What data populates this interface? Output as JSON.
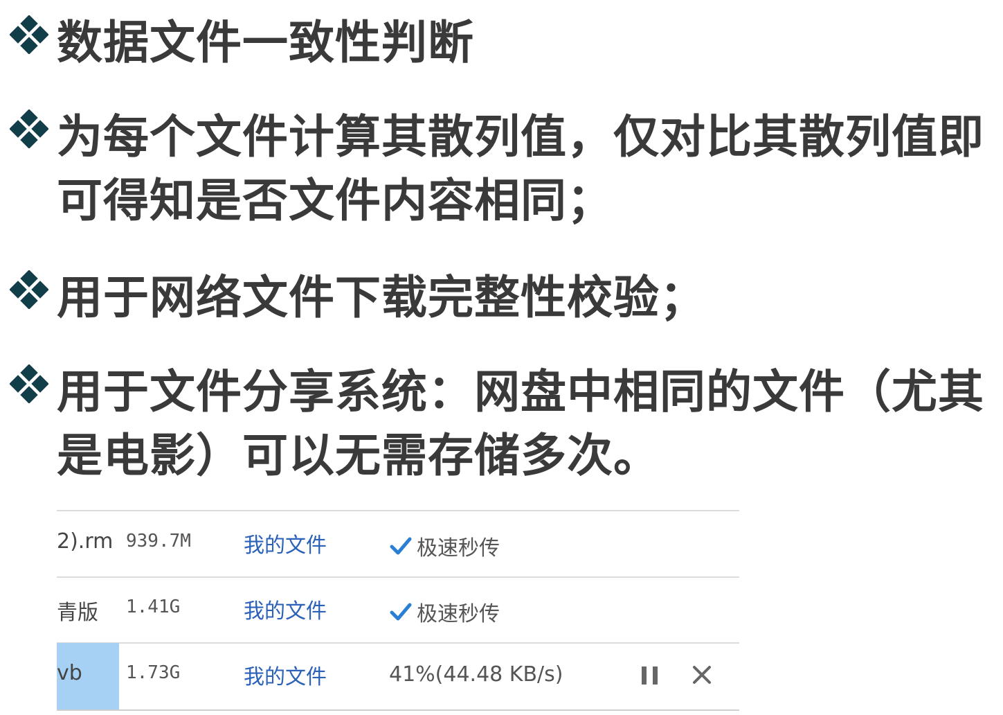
{
  "bullets": [
    {
      "text": "数据文件一致性判断"
    },
    {
      "text": "为每个文件计算其散列值，仅对比其散列值即可得知是否文件内容相同；"
    },
    {
      "text": "用于网络文件下载完整性校验；"
    },
    {
      "text": "用于文件分享系统：网盘中相同的文件（尤其是电影）可以无需存储多次。"
    }
  ],
  "download_list": {
    "rows": [
      {
        "name": "2).rm",
        "size": "939.7M",
        "location": "我的文件",
        "status": "极速秒传",
        "status_icon": "check-icon"
      },
      {
        "name": "青版",
        "size": "1.41G",
        "location": "我的文件",
        "status": "极速秒传",
        "status_icon": "check-icon"
      },
      {
        "name": "vb",
        "size": "1.73G",
        "location": "我的文件",
        "status": "41%(44.48 KB/s)",
        "progress_percent": 41,
        "actions": [
          "pause-icon",
          "close-icon"
        ]
      }
    ]
  },
  "colors": {
    "bullet_icon": "#113e48",
    "text": "#3a3a3a",
    "link": "#2b61b8",
    "check": "#2a7fd4",
    "progress": "#a7d0f5"
  }
}
